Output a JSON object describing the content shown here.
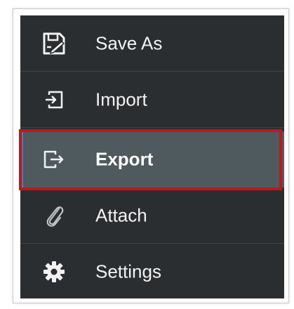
{
  "menu": {
    "items": [
      {
        "label": "Save As",
        "icon": "save-as-icon"
      },
      {
        "label": "Import",
        "icon": "import-icon"
      },
      {
        "label": "Export",
        "icon": "export-icon",
        "selected": true
      },
      {
        "label": "Attach",
        "icon": "paperclip-icon"
      },
      {
        "label": "Settings",
        "icon": "gear-icon"
      }
    ]
  },
  "colors": {
    "menu_background": "#2b2e30",
    "selected_background": "#4f5a5f",
    "highlight_border": "#c0161c",
    "text": "#f2f2f2"
  }
}
